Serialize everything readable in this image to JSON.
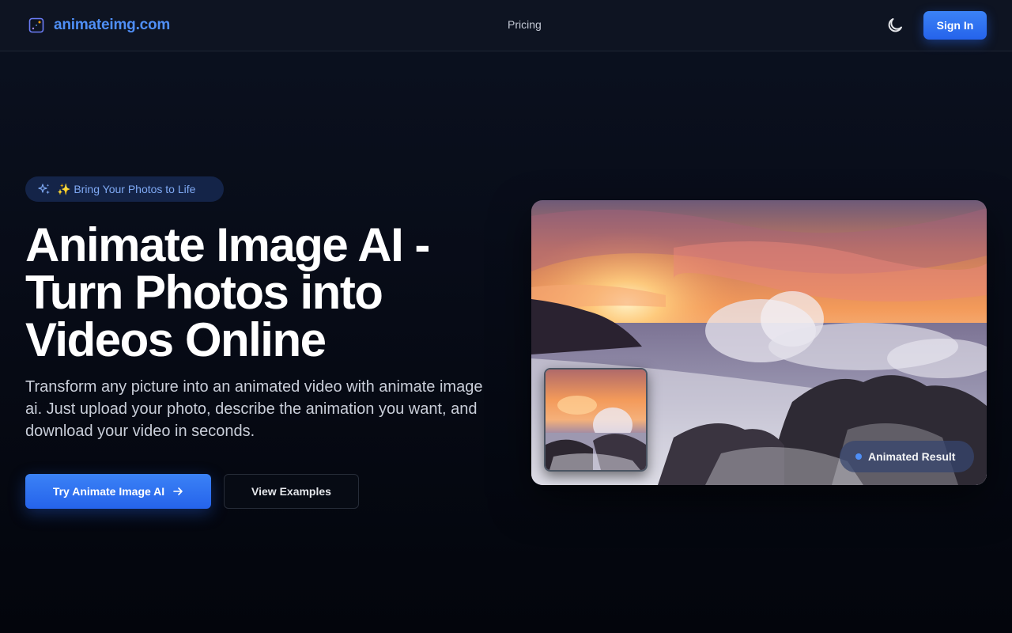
{
  "header": {
    "brand": "animateimg.com",
    "nav": {
      "pricing": "Pricing"
    },
    "sign_in": "Sign In",
    "logo_icon": "image-sparkle-icon",
    "theme_icon": "moon-icon"
  },
  "hero": {
    "pill": "✨ Bring Your Photos to Life",
    "pill_icon": "sparkles-icon",
    "title_lines": [
      "Animate Image AI -",
      "Turn Photos into",
      "Videos Online"
    ],
    "subtitle": "Transform any picture into an animated video with animate image ai. Just upload your photo, describe the animation you want, and download your video in seconds.",
    "primary_cta": "Try Animate Image AI",
    "primary_cta_icon": "arrow-right-icon",
    "secondary_cta": "View Examples",
    "image": {
      "description_icon": "sunset-waves-photo",
      "thumbnail": "sunset-waves-thumbnail",
      "badge": "Animated Result"
    }
  },
  "colors": {
    "accent": "#3b82f6",
    "brand_text": "#4f8ff7",
    "pill_bg": "#142448",
    "background": "#070b16"
  }
}
